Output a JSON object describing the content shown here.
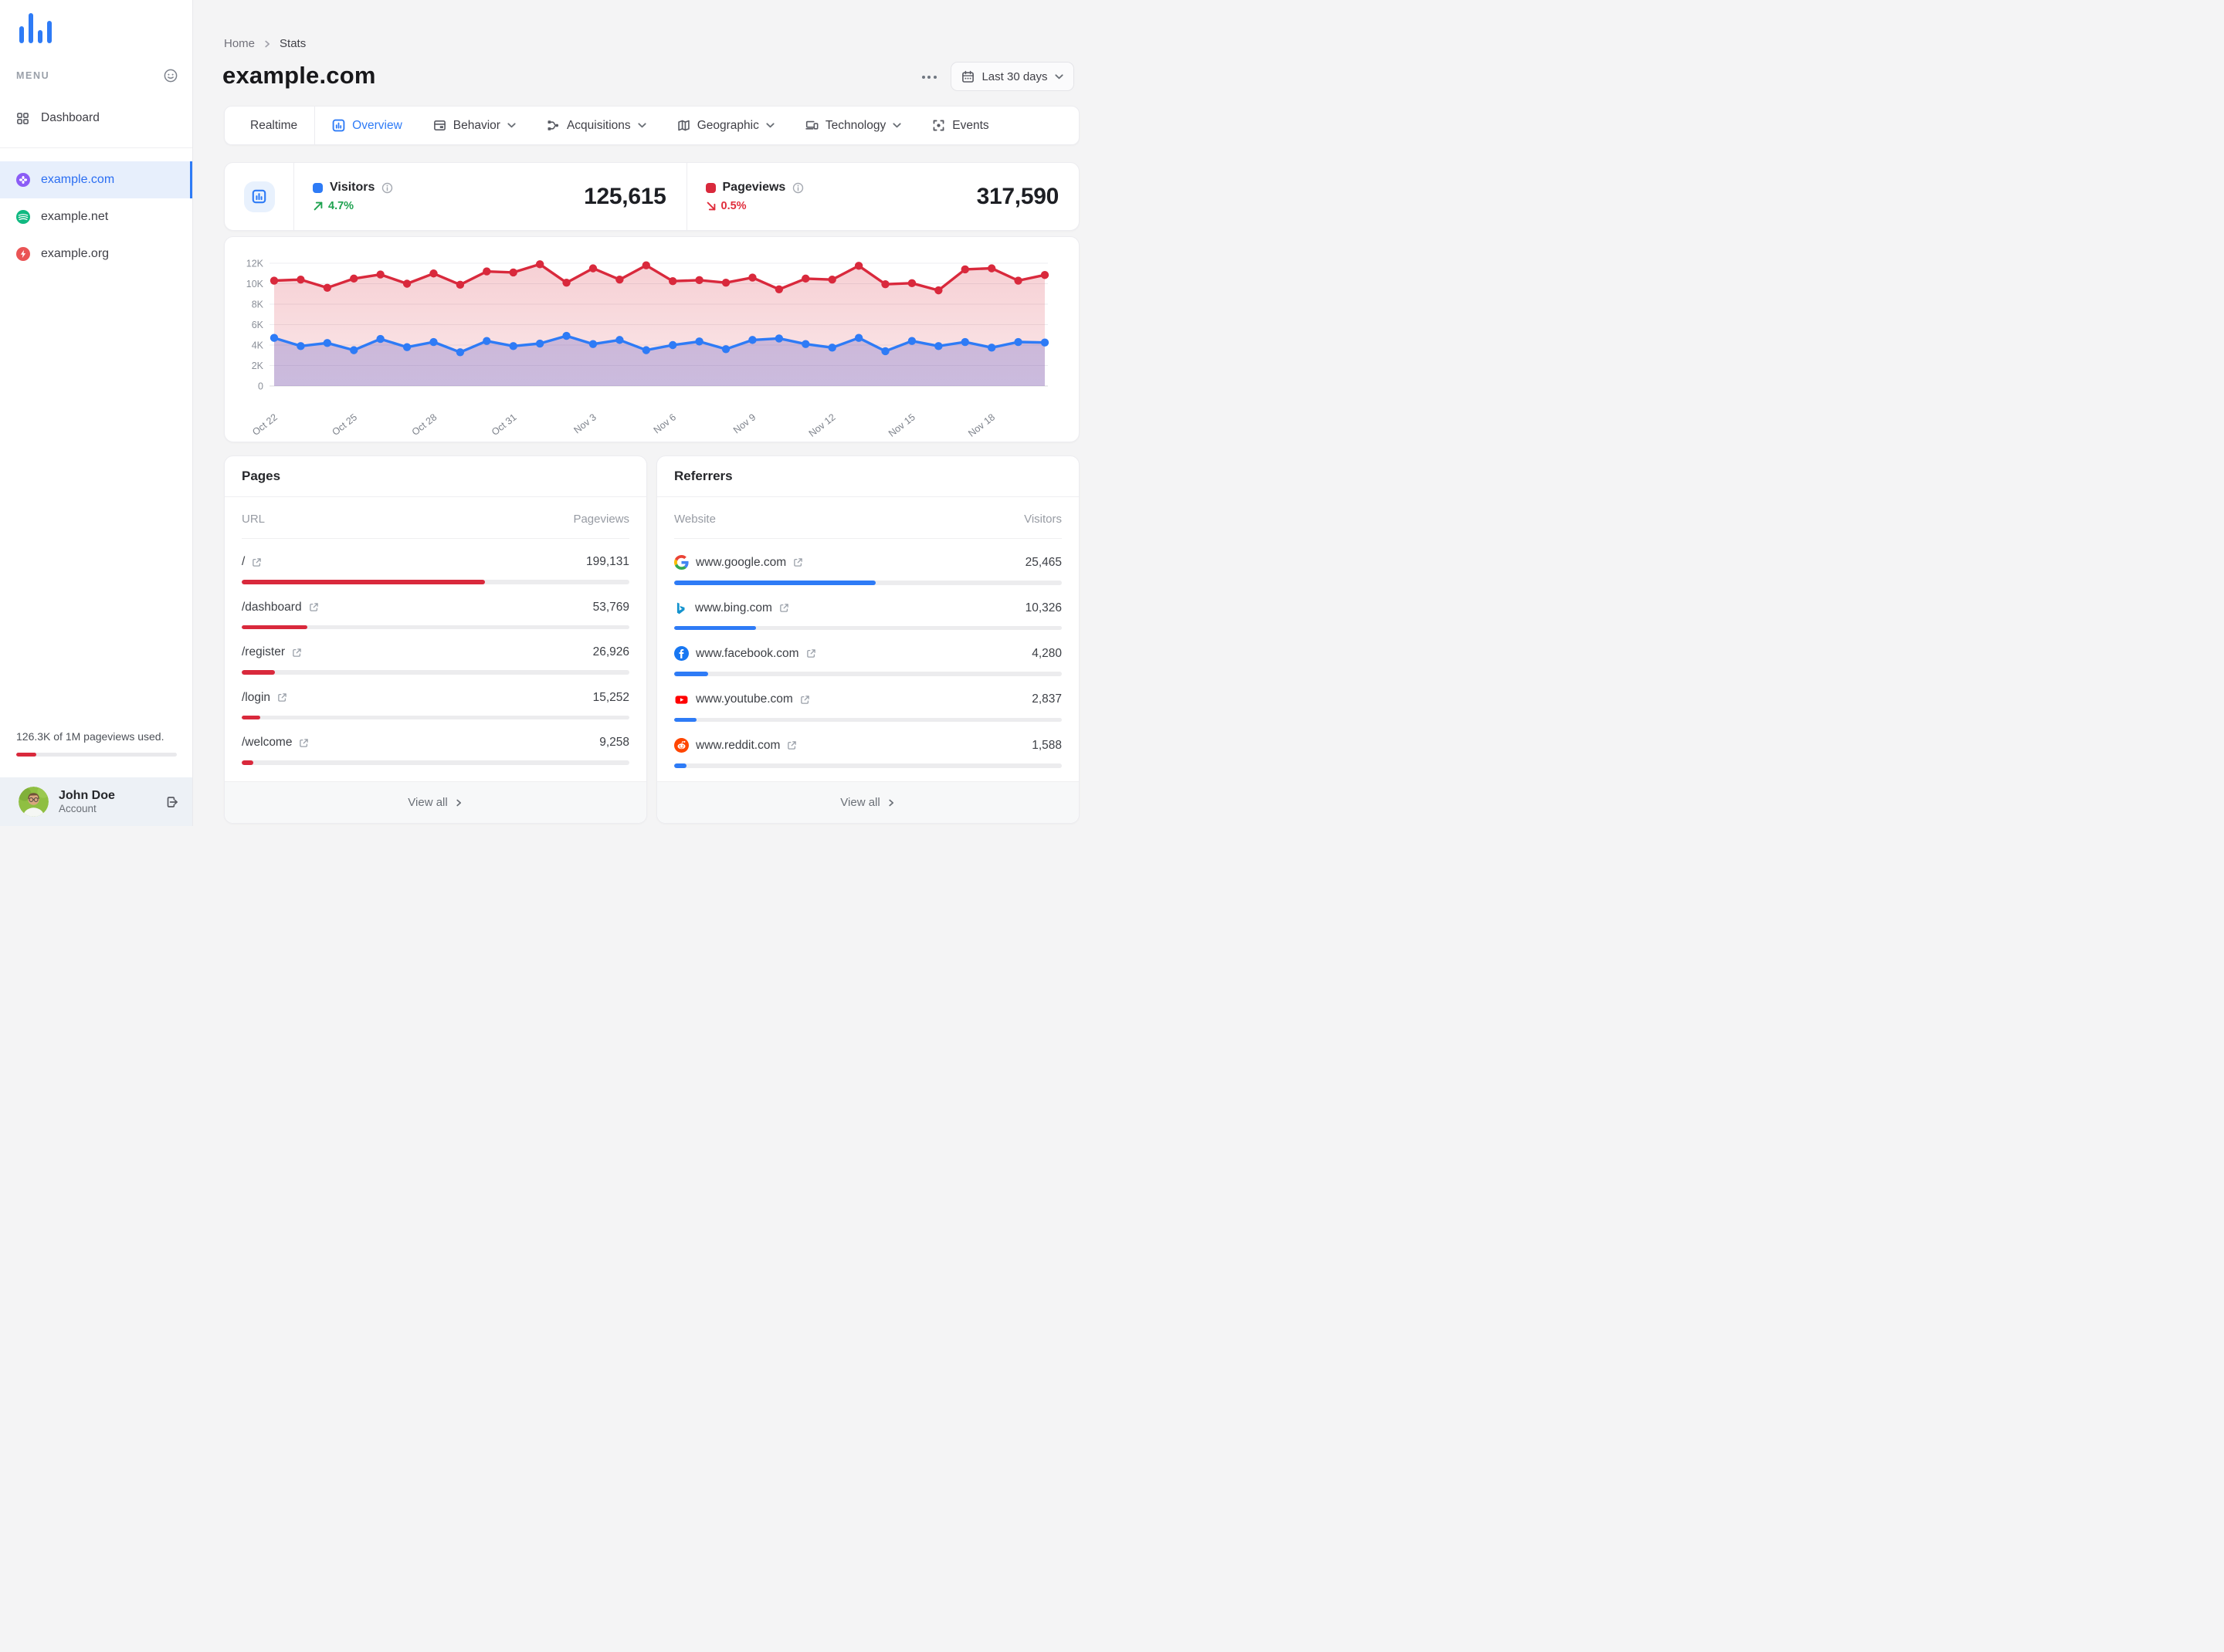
{
  "sidebar": {
    "logo_icon": "bar-chart-logo-icon",
    "menu_label": "MENU",
    "menu_icon": "face-icon",
    "items": [
      {
        "label": "Dashboard",
        "icon": "dashboard-grid-icon"
      }
    ],
    "sites": [
      {
        "label": "example.com",
        "icon": "purple-clover-favicon",
        "active": true
      },
      {
        "label": "example.net",
        "icon": "green-waves-favicon",
        "active": false
      },
      {
        "label": "example.org",
        "icon": "red-bolt-favicon",
        "active": false
      }
    ],
    "usage": {
      "text": "126.3K of 1M pageviews used.",
      "percent": 12.6
    },
    "account": {
      "name": "John Doe",
      "role": "Account",
      "logout_icon": "logout-icon"
    }
  },
  "header": {
    "breadcrumb": {
      "home": "Home",
      "current": "Stats"
    },
    "title": "example.com",
    "more_icon": "ellipsis-icon",
    "date_range": "Last 30 days",
    "date_icon": "calendar-icon"
  },
  "tabs": [
    {
      "label": "Realtime",
      "icon": "realtime-dot-icon",
      "active": false,
      "chevron": false,
      "divider_after": true
    },
    {
      "label": "Overview",
      "icon": "overview-chart-icon",
      "active": true,
      "chevron": false,
      "divider_after": false
    },
    {
      "label": "Behavior",
      "icon": "behavior-window-icon",
      "active": false,
      "chevron": true,
      "divider_after": false
    },
    {
      "label": "Acquisitions",
      "icon": "acquisitions-branch-icon",
      "active": false,
      "chevron": true,
      "divider_after": false
    },
    {
      "label": "Geographic",
      "icon": "geographic-map-icon",
      "active": false,
      "chevron": true,
      "divider_after": false
    },
    {
      "label": "Technology",
      "icon": "technology-devices-icon",
      "active": false,
      "chevron": true,
      "divider_after": false
    },
    {
      "label": "Events",
      "icon": "events-scan-icon",
      "active": false,
      "chevron": false,
      "divider_after": false
    }
  ],
  "stats": {
    "visitors": {
      "label": "Visitors",
      "value": "125,615",
      "change": "4.7%",
      "trend": "up",
      "color": "#2e7bf6"
    },
    "pageviews": {
      "label": "Pageviews",
      "value": "317,590",
      "change": "0.5%",
      "trend": "down",
      "color": "#d9293c"
    }
  },
  "chart_data": {
    "type": "area",
    "x": [
      "Oct 22",
      "Oct 23",
      "Oct 24",
      "Oct 25",
      "Oct 26",
      "Oct 27",
      "Oct 28",
      "Oct 29",
      "Oct 30",
      "Oct 31",
      "Nov 1",
      "Nov 2",
      "Nov 3",
      "Nov 4",
      "Nov 5",
      "Nov 6",
      "Nov 7",
      "Nov 8",
      "Nov 9",
      "Nov 10",
      "Nov 11",
      "Nov 12",
      "Nov 13",
      "Nov 14",
      "Nov 15",
      "Nov 16",
      "Nov 17",
      "Nov 18",
      "Nov 19",
      "Nov 20"
    ],
    "x_tick_every": 3,
    "series": [
      {
        "name": "Pageviews",
        "color": "#d9293c",
        "values": [
          10300,
          10400,
          9600,
          10500,
          10900,
          10000,
          11000,
          9900,
          11200,
          11100,
          11900,
          10100,
          11500,
          10400,
          11800,
          10250,
          10350,
          10100,
          10600,
          9450,
          10500,
          10400,
          11750,
          9950,
          10050,
          9350,
          11400,
          11500,
          10300,
          10850
        ]
      },
      {
        "name": "Visitors",
        "color": "#2e7bf6",
        "values": [
          4700,
          3900,
          4200,
          3500,
          4600,
          3800,
          4300,
          3300,
          4400,
          3900,
          4150,
          4900,
          4100,
          4500,
          3500,
          4000,
          4350,
          3600,
          4500,
          4650,
          4100,
          3750,
          4700,
          3400,
          4400,
          3900,
          4300,
          3750,
          4300,
          4250
        ]
      }
    ],
    "ylim": [
      0,
      12000
    ],
    "yticks": [
      0,
      2000,
      4000,
      6000,
      8000,
      10000,
      12000
    ],
    "ytick_labels": [
      "0",
      "2K",
      "4K",
      "6K",
      "8K",
      "10K",
      "12K"
    ],
    "grid": true,
    "legend_position": "none"
  },
  "pages": {
    "title": "Pages",
    "columns": [
      "URL",
      "Pageviews"
    ],
    "bar_color": "#d9293c",
    "rows": [
      {
        "label": "/",
        "value": "199,131",
        "bar_percent": 62.7
      },
      {
        "label": "/dashboard",
        "value": "53,769",
        "bar_percent": 16.9
      },
      {
        "label": "/register",
        "value": "26,926",
        "bar_percent": 8.5
      },
      {
        "label": "/login",
        "value": "15,252",
        "bar_percent": 4.8
      },
      {
        "label": "/welcome",
        "value": "9,258",
        "bar_percent": 2.9
      }
    ],
    "view_all": "View all"
  },
  "referrers": {
    "title": "Referrers",
    "columns": [
      "Website",
      "Visitors"
    ],
    "bar_color": "#2e7bf6",
    "rows": [
      {
        "label": "www.google.com",
        "favicon": "google-favicon",
        "value": "25,465",
        "bar_percent": 52.0
      },
      {
        "label": "www.bing.com",
        "favicon": "bing-favicon",
        "value": "10,326",
        "bar_percent": 21.1
      },
      {
        "label": "www.facebook.com",
        "favicon": "facebook-favicon",
        "value": "4,280",
        "bar_percent": 8.7
      },
      {
        "label": "www.youtube.com",
        "favicon": "youtube-favicon",
        "value": "2,837",
        "bar_percent": 5.8
      },
      {
        "label": "www.reddit.com",
        "favicon": "reddit-favicon",
        "value": "1,588",
        "bar_percent": 3.2
      }
    ],
    "view_all": "View all"
  }
}
